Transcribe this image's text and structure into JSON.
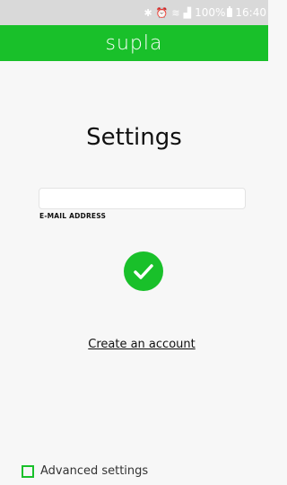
{
  "status_bar": {
    "icons": [
      "bluetooth-icon",
      "alarm-icon",
      "wifi-icon",
      "signal-icon",
      "battery-icon"
    ],
    "battery": "100%",
    "time": "16:40"
  },
  "app_bar": {
    "logo": "supla",
    "color": "#19c02a"
  },
  "main": {
    "title": "Settings",
    "email_input": {
      "value": "",
      "placeholder": ""
    },
    "email_label": "E-MAIL ADDRESS",
    "status_icon": "check-circle-icon",
    "create_account_link": "Create an account"
  },
  "footer": {
    "advanced_settings_label": "Advanced settings",
    "advanced_settings_checked": false
  }
}
